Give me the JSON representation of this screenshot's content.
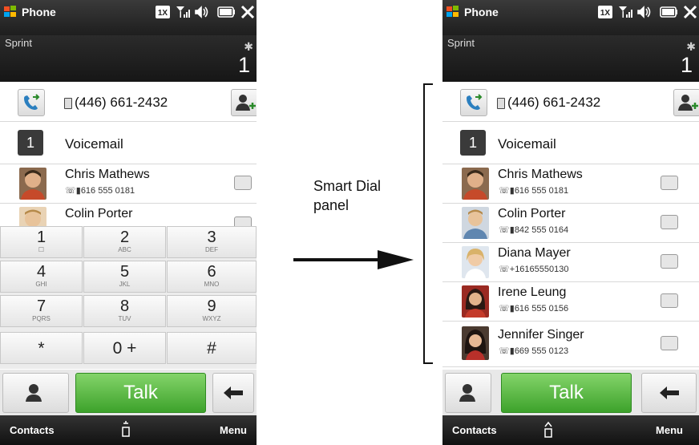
{
  "left_phone": {
    "status": {
      "title": "Phone",
      "network": "1X"
    },
    "header": {
      "carrier": "Sprint",
      "voicemail_count": "1"
    },
    "call_row": {
      "number": "(446) 661-2432"
    },
    "voicemail_row": {
      "badge": "1",
      "label": "Voicemail"
    },
    "contacts": [
      {
        "name": "Chris Mathews",
        "number": "616 555 0181"
      },
      {
        "name": "Colin Porter",
        "number": ""
      }
    ],
    "keypad": {
      "keys": [
        {
          "digit": "1",
          "letters": ""
        },
        {
          "digit": "2",
          "letters": "ABC"
        },
        {
          "digit": "3",
          "letters": "DEF"
        },
        {
          "digit": "4",
          "letters": "GHI"
        },
        {
          "digit": "5",
          "letters": "JKL"
        },
        {
          "digit": "6",
          "letters": "MNO"
        },
        {
          "digit": "7",
          "letters": "PQRS"
        },
        {
          "digit": "8",
          "letters": "TUV"
        },
        {
          "digit": "9",
          "letters": "WXYZ"
        },
        {
          "digit": "*",
          "letters": ""
        },
        {
          "digit": "0 +",
          "letters": ""
        },
        {
          "digit": "#",
          "letters": ""
        }
      ]
    },
    "talk_label": "Talk",
    "softkeys": {
      "left": "Contacts",
      "right": "Menu"
    }
  },
  "right_phone": {
    "status": {
      "title": "Phone",
      "network": "1X"
    },
    "header": {
      "carrier": "Sprint",
      "voicemail_count": "1"
    },
    "call_row": {
      "number": "(446) 661-2432"
    },
    "voicemail_row": {
      "badge": "1",
      "label": "Voicemail"
    },
    "contacts": [
      {
        "name": "Chris Mathews",
        "number": "616 555 0181"
      },
      {
        "name": "Colin Porter",
        "number": "842 555 0164"
      },
      {
        "name": "Diana Mayer",
        "number": "+16165550130"
      },
      {
        "name": "Irene Leung",
        "number": "616 555 0156"
      },
      {
        "name": "Jennifer Singer",
        "number": "669 555 0123"
      }
    ],
    "talk_label": "Talk",
    "softkeys": {
      "left": "Contacts",
      "right": "Menu"
    }
  },
  "callout": {
    "line1": "Smart Dial",
    "line2": "panel"
  },
  "colors": {
    "talk_green": "#4caf3a",
    "bar_dark": "#1e1e1e"
  }
}
